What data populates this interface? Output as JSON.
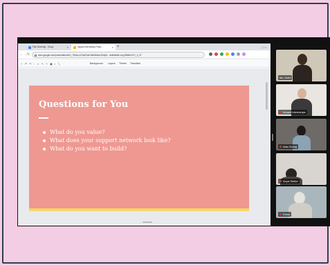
{
  "browser": {
    "tabs": [
      {
        "label": "Fish Diversity - Goog"
      },
      {
        "label": "Impact Internships Futur..."
      }
    ],
    "new_tab": "+",
    "window_controls": "– □ ×",
    "url": "docs.google.com/presentation/d/1_7bNuLoC3aG3uxOtdk3kAsrLHkqKz.../edit#slide=id.g1f8b5e47c7_0_37",
    "nav": {
      "back": "←",
      "forward": "→",
      "reload": "↻"
    }
  },
  "slides_toolbar": {
    "menus": [
      "Background",
      "Layout",
      "Theme",
      "Transition"
    ]
  },
  "slide": {
    "title": "Questions for You",
    "bullets": [
      "What do you value?",
      "What does your support network look like?",
      "What do you want to build?"
    ]
  },
  "participants": [
    {
      "name": "Ms. Kiahl"
    },
    {
      "name": "Impact Internships"
    },
    {
      "name": "Ada Chang"
    },
    {
      "name": "Anya Shirke"
    },
    {
      "name": "Khloe"
    }
  ],
  "colors": {
    "background": "#f3cde3",
    "slide": "#ee9891",
    "slide_accent": "#f6d865"
  }
}
